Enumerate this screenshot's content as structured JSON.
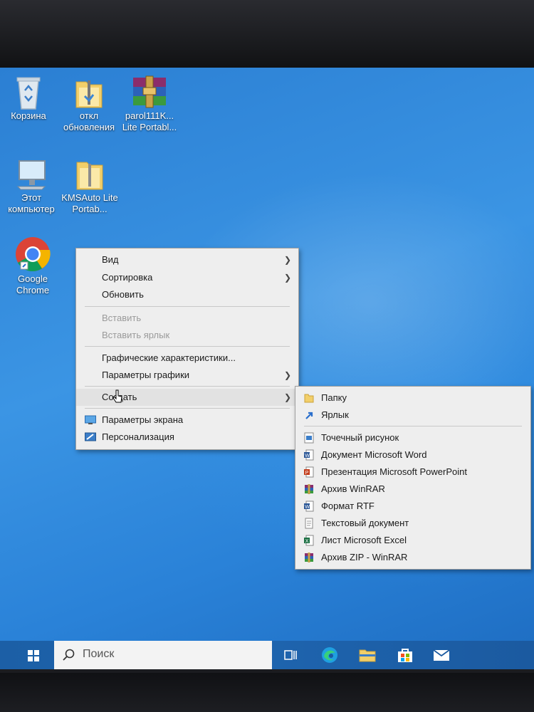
{
  "desktop": {
    "icons": [
      {
        "label": "Корзина",
        "icon": "recycle-bin-icon"
      },
      {
        "label": "откл обновления",
        "icon": "folder-zipper-icon"
      },
      {
        "label": "parol111K... Lite Portabl...",
        "icon": "winrar-icon"
      },
      {
        "label": "Этот компьютер",
        "icon": "computer-icon"
      },
      {
        "label": "KMSAuto Lite Portab...",
        "icon": "folder-icon"
      },
      {
        "label": "Google Chrome",
        "icon": "chrome-icon"
      }
    ]
  },
  "context_menu": {
    "items": [
      {
        "label": "Вид",
        "submenu": true
      },
      {
        "label": "Сортировка",
        "submenu": true
      },
      {
        "label": "Обновить"
      },
      {
        "label": "Вставить",
        "disabled": true
      },
      {
        "label": "Вставить ярлык",
        "disabled": true
      },
      {
        "label": "Графические характеристики..."
      },
      {
        "label": "Параметры графики",
        "submenu": true
      },
      {
        "label": "Создать",
        "submenu": true
      },
      {
        "label": "Параметры экрана",
        "icon": "display-settings-icon"
      },
      {
        "label": "Персонализация",
        "icon": "personalization-icon"
      }
    ]
  },
  "new_submenu": {
    "items": [
      {
        "label": "Папку",
        "icon": "folder-icon"
      },
      {
        "label": "Ярлык",
        "icon": "shortcut-icon"
      },
      {
        "label": "Точечный рисунок",
        "icon": "bitmap-icon"
      },
      {
        "label": "Документ Microsoft Word",
        "icon": "word-icon"
      },
      {
        "label": "Презентация Microsoft PowerPoint",
        "icon": "powerpoint-icon"
      },
      {
        "label": "Архив WinRAR",
        "icon": "winrar-icon"
      },
      {
        "label": "Формат RTF",
        "icon": "rtf-icon"
      },
      {
        "label": "Текстовый документ",
        "icon": "text-doc-icon"
      },
      {
        "label": "Лист Microsoft Excel",
        "icon": "excel-icon"
      },
      {
        "label": "Архив ZIP - WinRAR",
        "icon": "zip-winrar-icon"
      }
    ]
  },
  "taskbar": {
    "search_placeholder": "Поиск",
    "buttons": [
      "start-icon",
      "task-view-icon",
      "edge-icon",
      "file-explorer-icon",
      "store-icon",
      "mail-icon"
    ]
  }
}
